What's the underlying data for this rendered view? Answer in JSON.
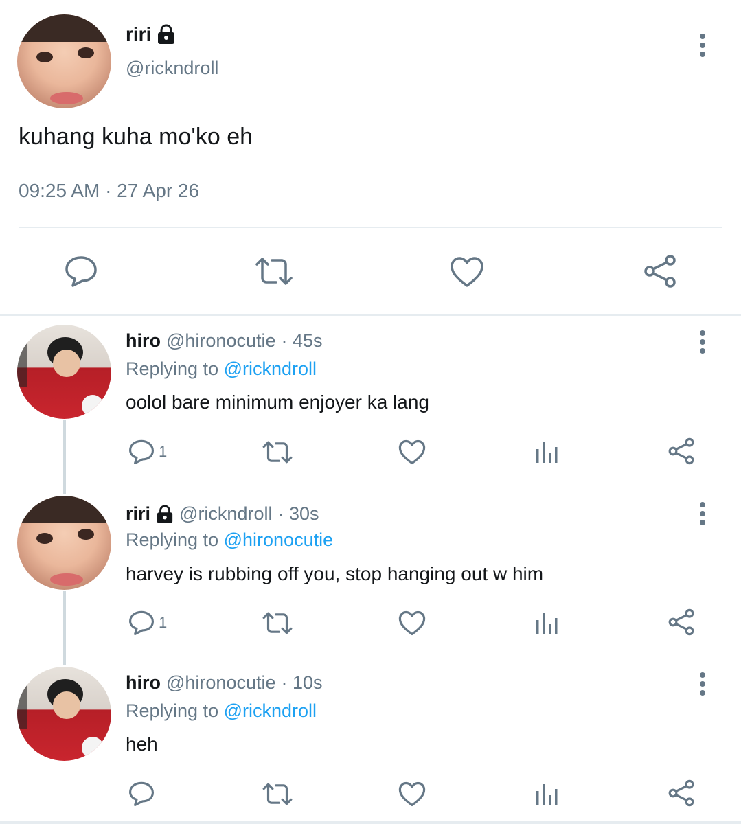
{
  "colors": {
    "text": "#14171a",
    "muted": "#657786",
    "link": "#1da1f2",
    "divider": "#e6ecf0"
  },
  "main_tweet": {
    "name": "riri",
    "handle": "@rickndroll",
    "text": "kuhang kuha mo'ko eh",
    "timestamp": "09:25 AM · 27 Apr 26",
    "locked_icon": "lock-icon",
    "actions": [
      "reply-icon",
      "retweet-icon",
      "like-icon",
      "share-icon"
    ]
  },
  "replies": [
    {
      "name": "hiro",
      "handle": "@hironocutie",
      "time": "· 45s",
      "replying_prefix": "Replying to",
      "replying_to": "@rickndroll",
      "text": "oolol bare minimum enjoyer ka lang",
      "reply_count": "1"
    },
    {
      "name": "riri",
      "handle": "@rickndroll",
      "time": "· 30s",
      "replying_prefix": "Replying to",
      "replying_to": "@hironocutie",
      "text": "harvey is rubbing off you, stop hanging out w him",
      "reply_count": "1",
      "locked": true
    },
    {
      "name": "hiro",
      "handle": "@hironocutie",
      "time": "· 10s",
      "replying_prefix": "Replying to",
      "replying_to": "@rickndroll",
      "text": "heh",
      "reply_count": ""
    }
  ]
}
